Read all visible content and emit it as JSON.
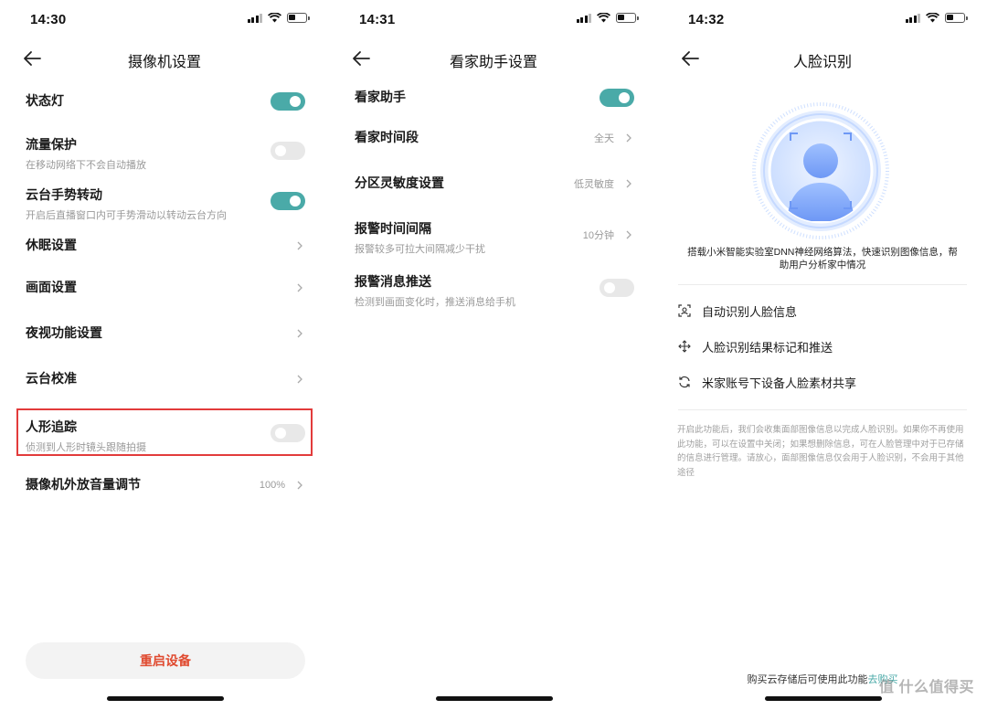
{
  "screen1": {
    "time": "14:30",
    "title": "摄像机设置",
    "rows": [
      {
        "label": "状态灯",
        "sub": "",
        "toggle": "on"
      },
      {
        "label": "流量保护",
        "sub": "在移动网络下不会自动播放",
        "toggle": "off"
      },
      {
        "label": "云台手势转动",
        "sub": "开启后直播窗口内可手势滑动以转动云台方向",
        "toggle": "on"
      },
      {
        "label": "休眠设置",
        "sub": ""
      },
      {
        "label": "画面设置",
        "sub": ""
      },
      {
        "label": "夜视功能设置",
        "sub": ""
      },
      {
        "label": "云台校准",
        "sub": ""
      },
      {
        "label": "人形追踪",
        "sub": "侦测到人形时镜头跟随拍摄",
        "toggle": "off"
      },
      {
        "label": "摄像机外放音量调节",
        "sub": "",
        "value": "100%"
      }
    ],
    "restart_label": "重启设备"
  },
  "screen2": {
    "time": "14:31",
    "title": "看家助手设置",
    "rows": [
      {
        "label": "看家助手",
        "sub": "",
        "toggle": "on"
      },
      {
        "label": "看家时间段",
        "sub": "",
        "value": "全天"
      },
      {
        "label": "分区灵敏度设置",
        "sub": "",
        "value": "低灵敏度"
      },
      {
        "label": "报警时间间隔",
        "sub": "报警较多可拉大间隔减少干扰",
        "value": "10分钟"
      },
      {
        "label": "报警消息推送",
        "sub": "检测到画面变化时，推送消息给手机",
        "toggle": "off"
      }
    ]
  },
  "screen3": {
    "time": "14:32",
    "title": "人脸识别",
    "description": "搭载小米智能实验室DNN神经网络算法，快速识别图像信息，帮助用户分析家中情况",
    "features": [
      {
        "label": "自动识别人脸信息",
        "icon": "face-scan-icon"
      },
      {
        "label": "人脸识别结果标记和推送",
        "icon": "move-arrows-icon"
      },
      {
        "label": "米家账号下设备人脸素材共享",
        "icon": "sync-icon"
      }
    ],
    "notice": "开启此功能后，我们会收集面部图像信息以完成人脸识别。如果你不再使用此功能，可以在设置中关闭；如果想删除信息，可在人脸管理中对于已存储的信息进行管理。请放心，面部图像信息仅会用于人脸识别，不会用于其他途径",
    "footer_text": "购买云存储后可使用此功能",
    "footer_link": "去购买"
  },
  "watermark": "值 什么值得买",
  "colors": {
    "accent": "#4aaaa8",
    "danger": "#e04a2f",
    "highlight_border": "#e23b3b"
  }
}
